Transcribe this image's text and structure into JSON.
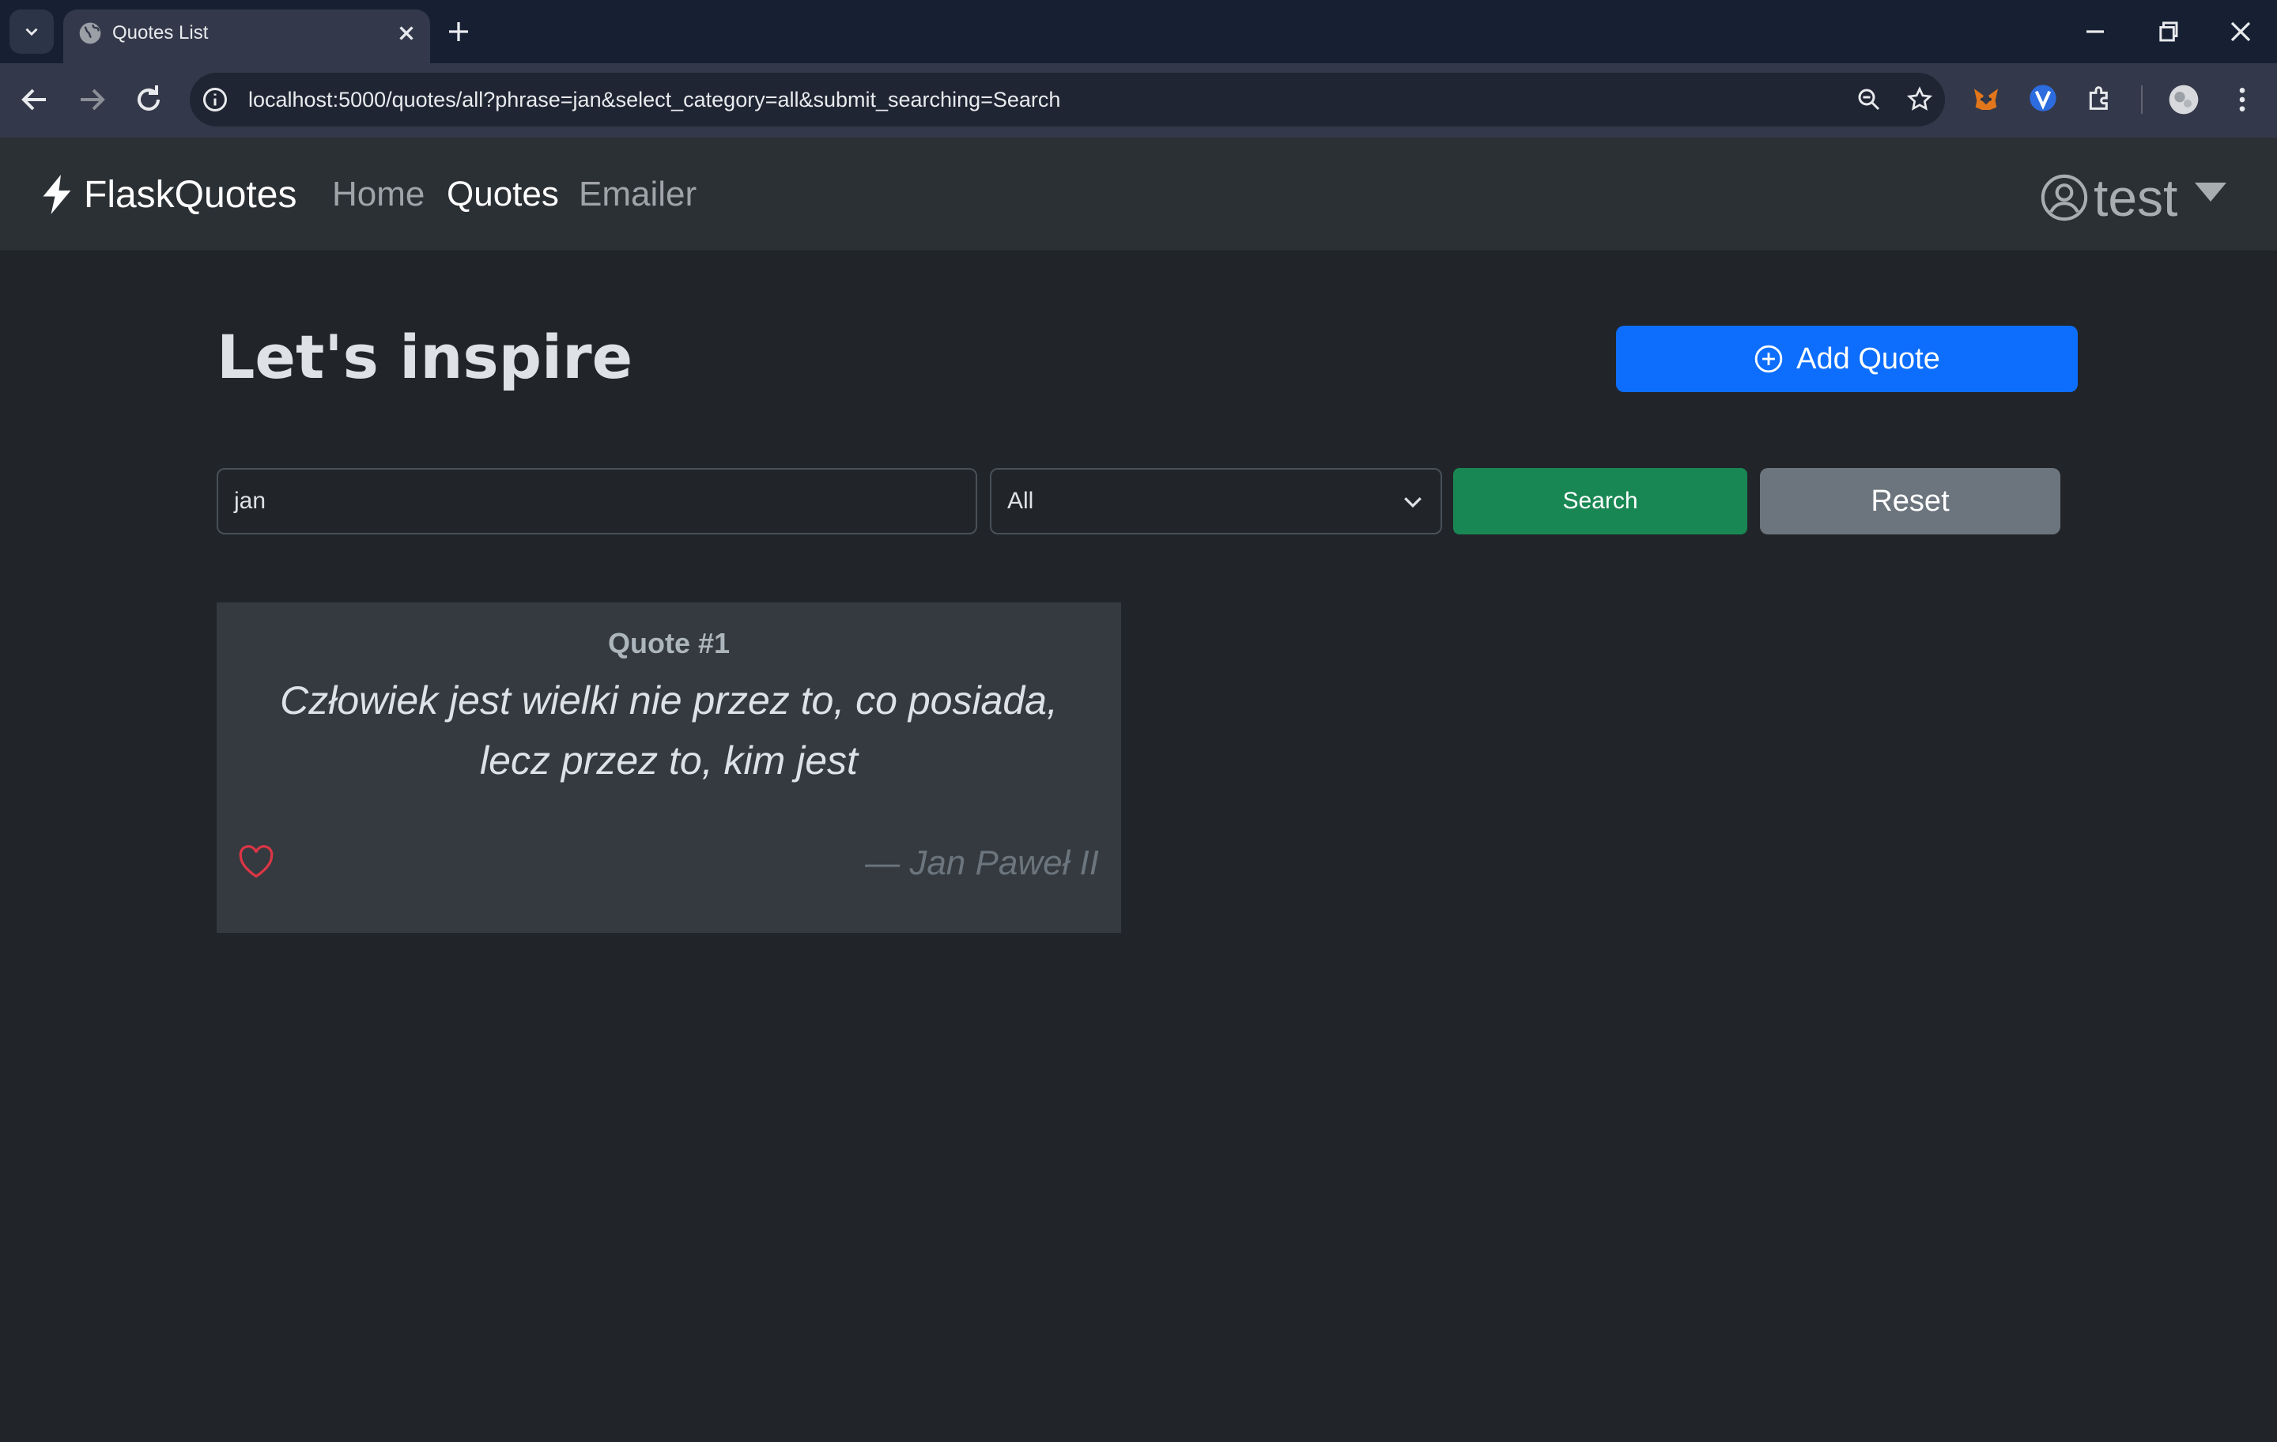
{
  "browser": {
    "tab_title": "Quotes List",
    "url": "localhost:5000/quotes/all?phrase=jan&select_category=all&submit_searching=Search"
  },
  "navbar": {
    "brand": "FlaskQuotes",
    "links": [
      "Home",
      "Quotes",
      "Emailer"
    ],
    "active_link": "Quotes",
    "user": "test"
  },
  "main": {
    "title": "Let's inspire",
    "add_button": "Add Quote",
    "search": {
      "value": "jan"
    },
    "category": {
      "selected": "All"
    },
    "search_button": "Search",
    "reset_button": "Reset"
  },
  "quotes": [
    {
      "number": "Quote #1",
      "text": "Człowiek jest wielki nie przez to, co posiada, lecz przez to, kim jest",
      "author": "— Jan Paweł II"
    }
  ],
  "colors": {
    "primary": "#0d6efd",
    "success": "#198754",
    "secondary": "#6c757d",
    "like": "#dc3545"
  },
  "icons": {
    "brand": "lightning-icon",
    "user": "person-circle-icon",
    "add": "plus-circle-icon",
    "like": "heart-icon"
  }
}
